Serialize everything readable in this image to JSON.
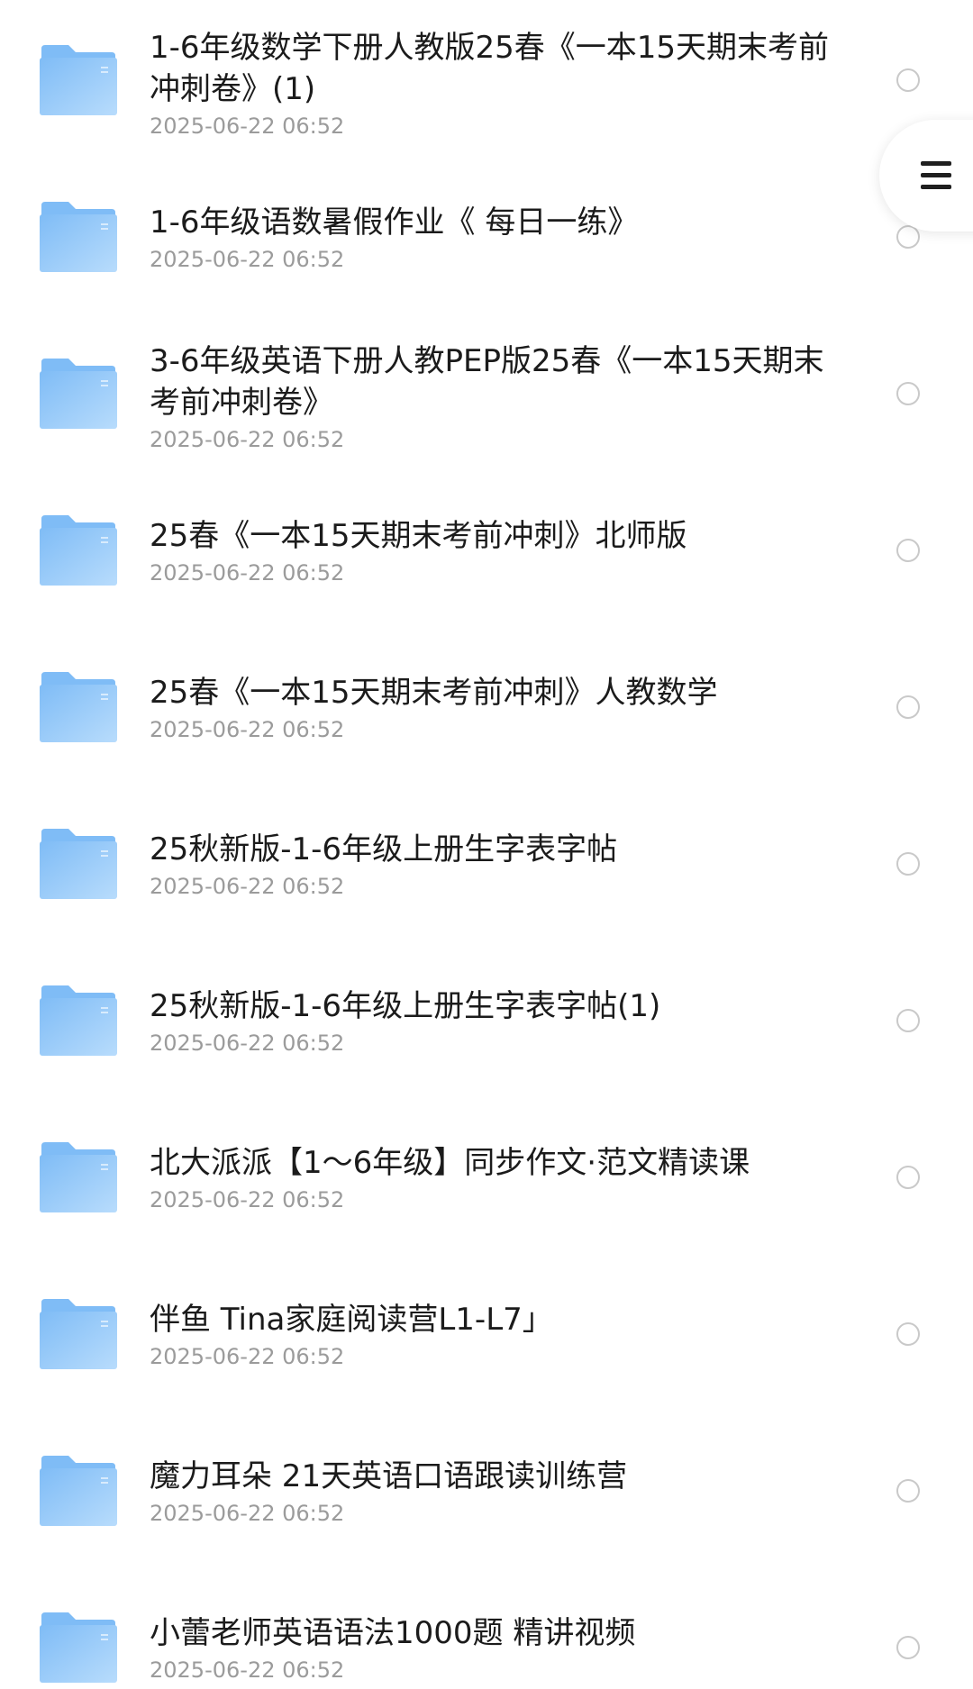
{
  "colors": {
    "folder": "#7fbcf6",
    "folder_light": "#b8dcfc",
    "name_text": "#1b1b1b",
    "date_text": "#9b9b9b",
    "radio_border": "#c9c9c9"
  },
  "menu_button": {
    "icon": "hamburger-menu-icon"
  },
  "files": [
    {
      "name": "1-6年级数学下册人教版25春《一本15天期末考前冲刺卷》(1)",
      "date": "2025-06-22 06:52"
    },
    {
      "name": "1-6年级语数暑假作业《 每日一练》",
      "date": "2025-06-22 06:52"
    },
    {
      "name": "3-6年级英语下册人教PEP版25春《一本15天期末考前冲刺卷》",
      "date": "2025-06-22 06:52"
    },
    {
      "name": "25春《一本15天期末考前冲刺》北师版",
      "date": "2025-06-22 06:52"
    },
    {
      "name": "25春《一本15天期末考前冲刺》人教数学",
      "date": "2025-06-22 06:52"
    },
    {
      "name": "25秋新版-1-6年级上册生字表字帖",
      "date": "2025-06-22 06:52"
    },
    {
      "name": "25秋新版-1-6年级上册生字表字帖(1)",
      "date": "2025-06-22 06:52"
    },
    {
      "name": "北大派派【1～6年级】同步作文·范文精读课",
      "date": "2025-06-22 06:52"
    },
    {
      "name": "伴鱼 Tina家庭阅读营L1-L7」",
      "date": "2025-06-22 06:52"
    },
    {
      "name": "魔力耳朵 21天英语口语跟读训练营",
      "date": "2025-06-22 06:52"
    },
    {
      "name": "小蕾老师英语语法1000题 精讲视频",
      "date": "2025-06-22 06:52"
    }
  ]
}
